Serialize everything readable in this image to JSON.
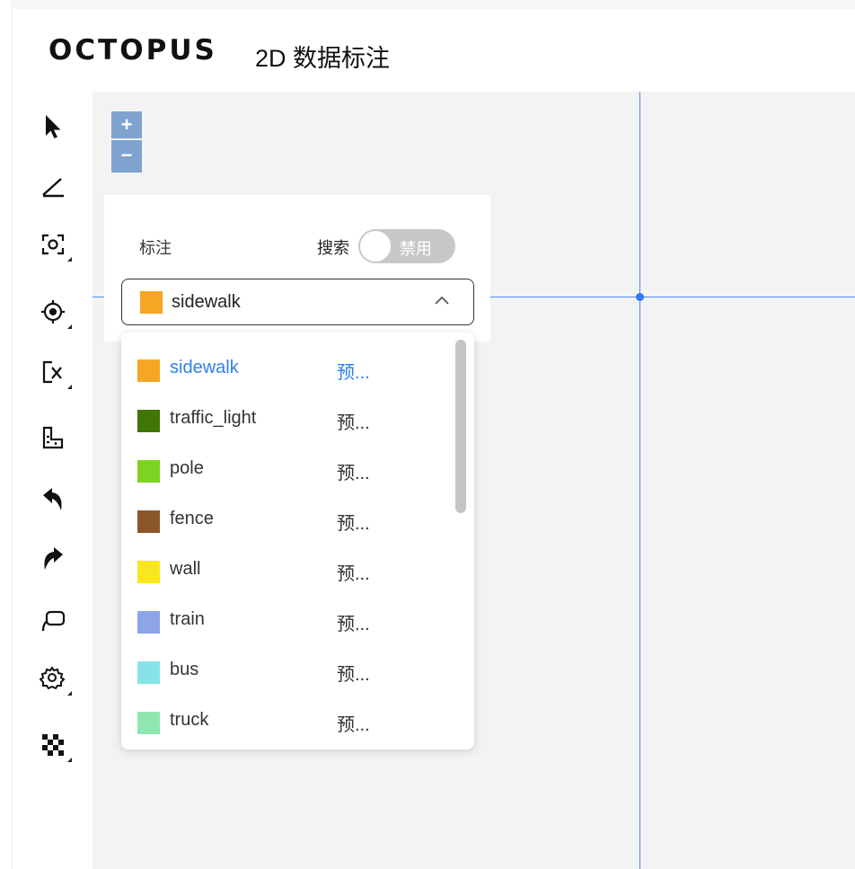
{
  "app": {
    "brand": "OCTOPUS",
    "subtitle": "2D 数据标注"
  },
  "toolbar": {
    "tools": [
      {
        "name": "select-arrow-icon"
      },
      {
        "name": "line-icon"
      },
      {
        "name": "focus-target-icon"
      },
      {
        "name": "point-target-icon"
      },
      {
        "name": "box-x-icon"
      },
      {
        "name": "ruler-shape-icon"
      },
      {
        "name": "undo-icon"
      },
      {
        "name": "redo-icon"
      },
      {
        "name": "lasso-icon"
      },
      {
        "name": "settings-icon"
      },
      {
        "name": "checkerboard-icon"
      }
    ]
  },
  "zoom": {
    "in_label": "+",
    "out_label": "−"
  },
  "panel": {
    "label": "标注",
    "search_label": "搜索",
    "toggle_text": "禁用",
    "toggle_on": false,
    "selected": {
      "label": "sidewalk",
      "color": "#f5a623"
    }
  },
  "dropdown": {
    "options": [
      {
        "label": "sidewalk",
        "extra": "预...",
        "color": "#f5a623",
        "active": true
      },
      {
        "label": "traffic_light",
        "extra": "预...",
        "color": "#417505",
        "active": false
      },
      {
        "label": "pole",
        "extra": "预...",
        "color": "#7ed321",
        "active": false
      },
      {
        "label": "fence",
        "extra": "预...",
        "color": "#8b572a",
        "active": false
      },
      {
        "label": "wall",
        "extra": "预...",
        "color": "#f8e71c",
        "active": false
      },
      {
        "label": "train",
        "extra": "预...",
        "color": "#8da4e8",
        "active": false
      },
      {
        "label": "bus",
        "extra": "预...",
        "color": "#86e3e8",
        "active": false
      },
      {
        "label": "truck",
        "extra": "预...",
        "color": "#8ee6b0",
        "active": false
      }
    ]
  },
  "colors": {
    "crosshair": "#4a8cf7",
    "zoom_button": "#7fa3cf",
    "active_text": "#2f80ed",
    "canvas": "#f3f3f3"
  }
}
